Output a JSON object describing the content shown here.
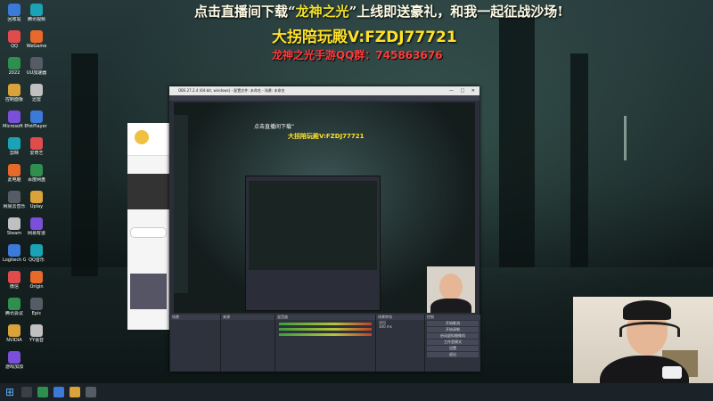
{
  "overlay": {
    "line1_prefix": "点击直播间下载“",
    "line1_highlight": "龙神之光",
    "line1_suffix": "”上线即送豪礼，和我一起征战沙场!",
    "line2": "大拐陪玩殿V:FZDJ77721",
    "line3": "龙神之光手游QQ群：745863676"
  },
  "obs": {
    "title": "OBS 27.2.4 (64-bit, windows) - 配置文件: 未命名 - 场景: 未命名",
    "panels": {
      "scenes": "场景",
      "sources": "来源",
      "mixer": "混音器",
      "transitions": "场景转场",
      "controls": "控制"
    },
    "controls": [
      "开始推流",
      "开始录制",
      "启动虚拟摄像机",
      "工作室模式",
      "设置",
      "退出"
    ],
    "transition_name": "淡出",
    "transition_duration": "300 ms",
    "status": "LIVE: 00:00:00  REC: 00:00:00  CPU: 12.5%, 30.00 fps"
  },
  "desktop_icons": [
    "回收站",
    "QQ",
    "2022",
    "控制面板",
    "Microsoft Edge",
    "剪映",
    "此电脑",
    "网易云音乐",
    "Steam",
    "Logitech G HUB",
    "微信",
    "腾讯会议",
    "NVIDIA",
    "游戏加加",
    "腾讯视频",
    "WeGame",
    "UU加速器",
    "迅雷",
    "PotPlayer",
    "爱奇艺",
    "百度网盘",
    "Uplay",
    "网易有道",
    "QQ音乐",
    "Origin",
    "Epic",
    "YY语音"
  ],
  "taskbar": {
    "start_icon": "windows-logo-icon"
  },
  "colors": {
    "overlay_white": "#fffbe6",
    "overlay_yellow": "#ffe12a",
    "overlay_red": "#ff3b3b",
    "obs_bg": "#2b2e38"
  }
}
